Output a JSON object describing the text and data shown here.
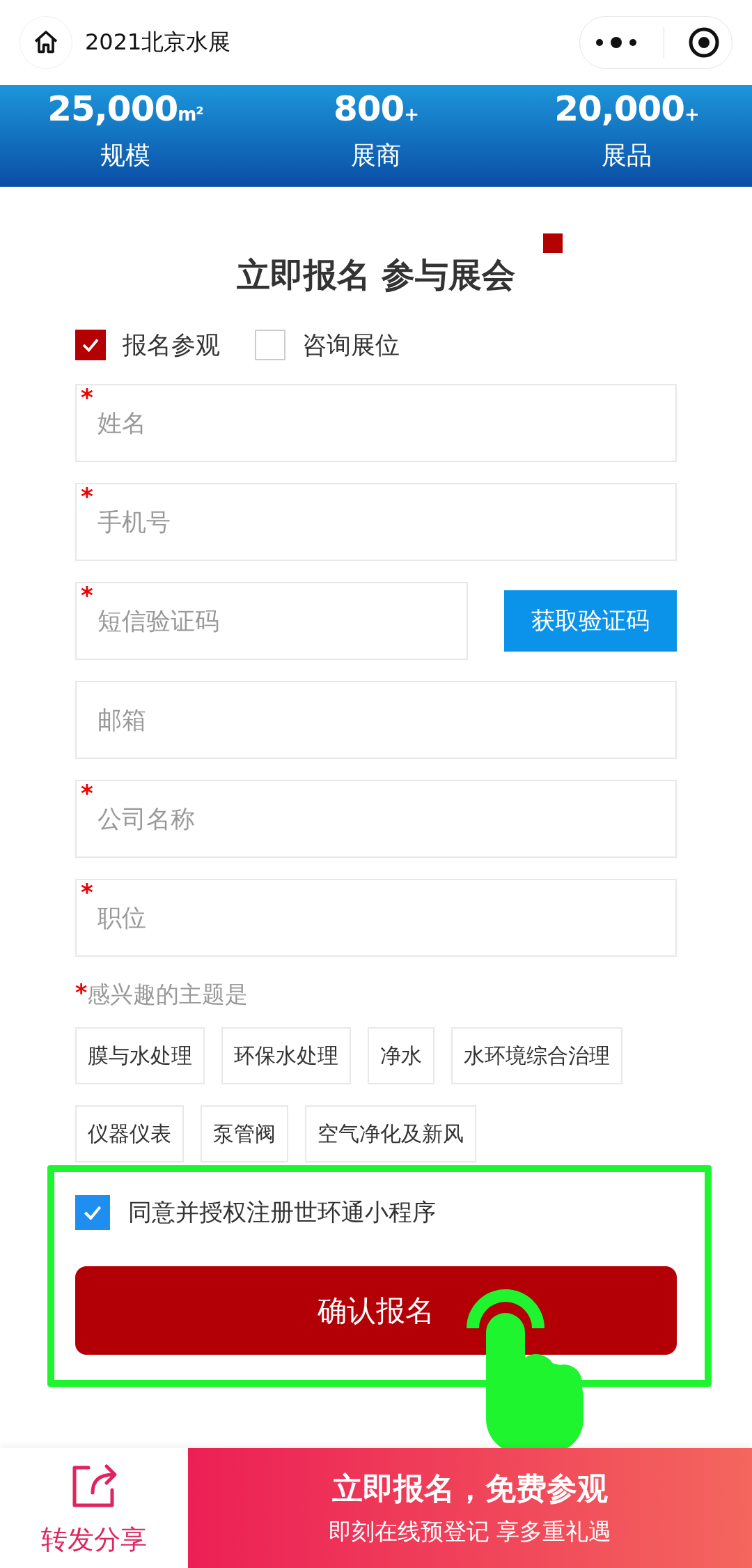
{
  "header": {
    "title": "2021北京水展"
  },
  "banner": {
    "stats": [
      {
        "value": "25,000",
        "unit": "m²",
        "label": "规模"
      },
      {
        "value": "800",
        "unit": "+",
        "label": "展商"
      },
      {
        "value": "20,000",
        "unit": "+",
        "label": "展品"
      }
    ]
  },
  "form": {
    "title": "立即报名 参与展会",
    "options": [
      {
        "label": "报名参观",
        "selected": true
      },
      {
        "label": "咨询展位",
        "selected": false
      }
    ],
    "fields": [
      {
        "kind": "text",
        "placeholder": "姓名",
        "required_mark": "*"
      },
      {
        "kind": "text",
        "placeholder": "手机号",
        "required_mark": "*"
      },
      {
        "kind": "sms",
        "placeholder": "短信验证码",
        "required_mark": "*",
        "button": "获取验证码"
      },
      {
        "kind": "text",
        "placeholder": "邮箱"
      },
      {
        "kind": "text",
        "placeholder": "公司名称",
        "required_mark": "*"
      },
      {
        "kind": "text",
        "placeholder": "职位",
        "required_mark": "*"
      }
    ],
    "interest_label": "感兴趣的主题是",
    "interest_mark": "*",
    "topics": [
      "膜与水处理",
      "环保水处理",
      "净水",
      "水环境综合治理",
      "仪器仪表",
      "泵管阀",
      "空气净化及新风"
    ],
    "agree": {
      "label": "同意并授权注册世环通小程序",
      "checked": true
    },
    "submit": "确认报名"
  },
  "bottom_bar": {
    "share": "转发分享",
    "cta_title": "立即报名，免费参观",
    "cta_subtitle": "即刻在线预登记 享多重礼遇"
  }
}
